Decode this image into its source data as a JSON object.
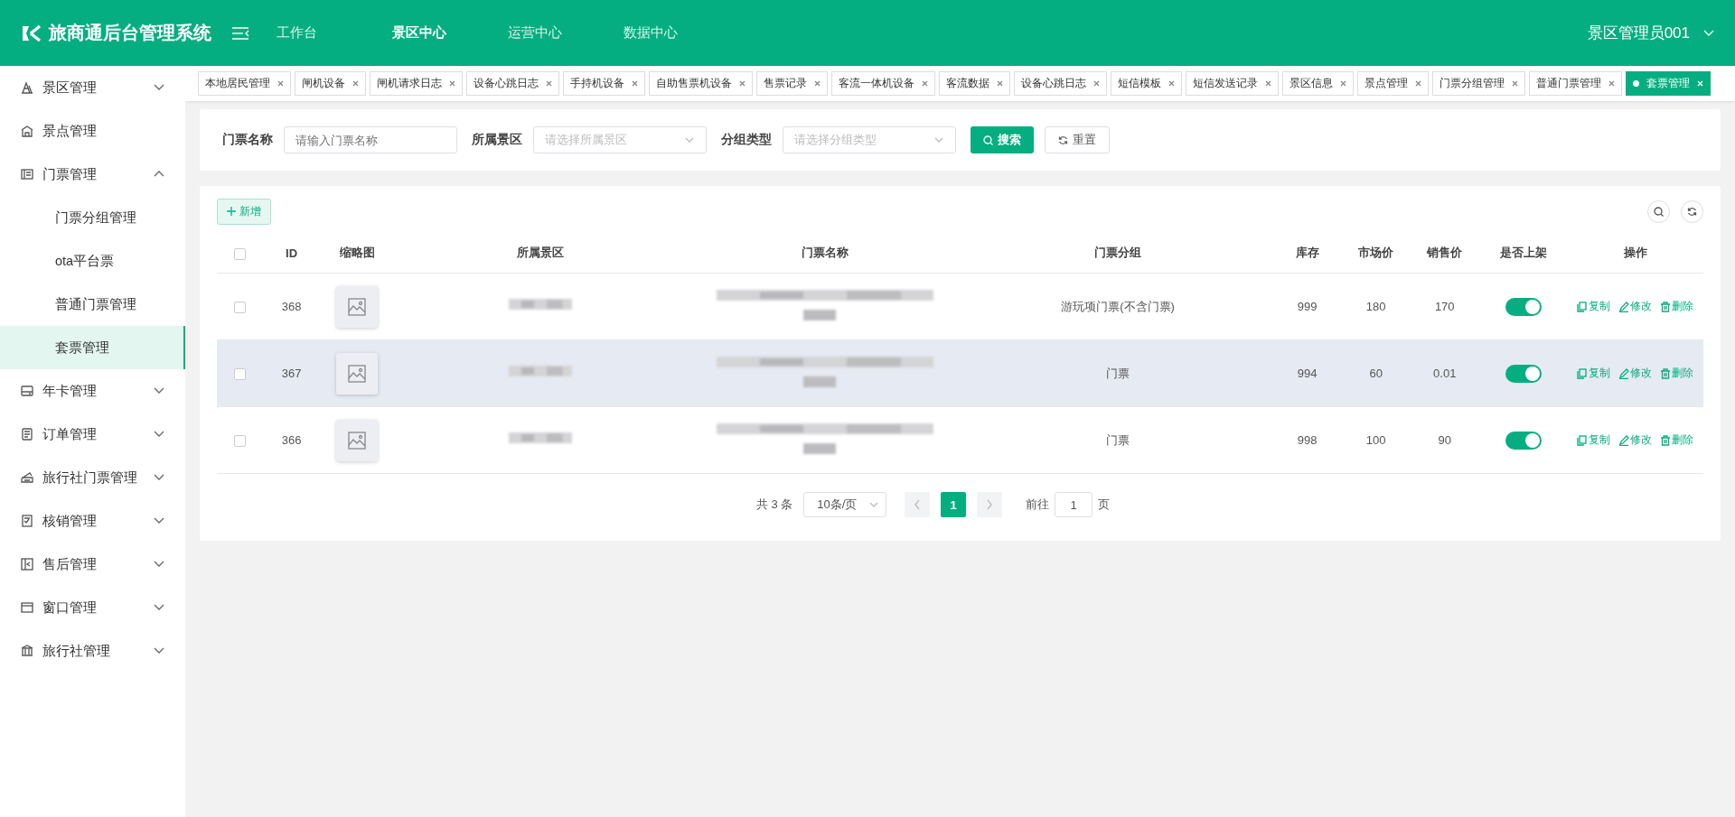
{
  "header": {
    "title": "旅商通后台管理系统",
    "nav": [
      {
        "label": "工作台",
        "selected": false
      },
      {
        "label": "景区中心",
        "selected": true
      },
      {
        "label": "运营中心",
        "selected": false
      },
      {
        "label": "数据中心",
        "selected": false
      }
    ],
    "user": "景区管理员001"
  },
  "sidebar": {
    "items": [
      {
        "label": "景区管理",
        "kind": "group",
        "expanded": false,
        "selected": false
      },
      {
        "label": "景点管理",
        "kind": "link",
        "selected": false
      },
      {
        "label": "门票管理",
        "kind": "group",
        "expanded": true,
        "selected": false,
        "children": [
          {
            "label": "门票分组管理",
            "selected": false
          },
          {
            "label": "ota平台票",
            "selected": false
          },
          {
            "label": "普通门票管理",
            "selected": false
          },
          {
            "label": "套票管理",
            "selected": true
          }
        ]
      },
      {
        "label": "年卡管理",
        "kind": "group",
        "expanded": false,
        "selected": false
      },
      {
        "label": "订单管理",
        "kind": "group",
        "expanded": false,
        "selected": false
      },
      {
        "label": "旅行社门票管理",
        "kind": "group",
        "expanded": false,
        "selected": false
      },
      {
        "label": "核销管理",
        "kind": "group",
        "expanded": false,
        "selected": false
      },
      {
        "label": "售后管理",
        "kind": "group",
        "expanded": false,
        "selected": false
      },
      {
        "label": "窗口管理",
        "kind": "group",
        "expanded": false,
        "selected": false
      },
      {
        "label": "旅行社管理",
        "kind": "group",
        "expanded": false,
        "selected": false
      }
    ]
  },
  "tabs": [
    {
      "label": "本地居民管理",
      "selected": false
    },
    {
      "label": "闸机设备",
      "selected": false
    },
    {
      "label": "闸机请求日志",
      "selected": false
    },
    {
      "label": "设备心跳日志",
      "selected": false
    },
    {
      "label": "手持机设备",
      "selected": false
    },
    {
      "label": "自助售票机设备",
      "selected": false
    },
    {
      "label": "售票记录",
      "selected": false
    },
    {
      "label": "客流一体机设备",
      "selected": false
    },
    {
      "label": "客流数据",
      "selected": false
    },
    {
      "label": "设备心跳日志",
      "selected": false
    },
    {
      "label": "短信模板",
      "selected": false
    },
    {
      "label": "短信发送记录",
      "selected": false
    },
    {
      "label": "景区信息",
      "selected": false
    },
    {
      "label": "景点管理",
      "selected": false
    },
    {
      "label": "门票分组管理",
      "selected": false
    },
    {
      "label": "普通门票管理",
      "selected": false
    },
    {
      "label": "套票管理",
      "selected": true
    }
  ],
  "search": {
    "fields": [
      {
        "label": "门票名称",
        "kind": "input",
        "placeholder": "请输入门票名称"
      },
      {
        "label": "所属景区",
        "kind": "select",
        "placeholder": "请选择所属景区"
      },
      {
        "label": "分组类型",
        "kind": "select",
        "placeholder": "请选择分组类型"
      }
    ],
    "buttons": [
      {
        "label": "搜索",
        "kind": "primary"
      },
      {
        "label": "重置",
        "kind": "plain"
      }
    ]
  },
  "table": {
    "add_button": "新增",
    "columns": [
      "ID",
      "缩略图",
      "所属景区",
      "门票名称",
      "门票分组",
      "库存",
      "市场价",
      "销售价",
      "是否上架",
      "操作"
    ],
    "header_checked": false,
    "rows": [
      {
        "checked": false,
        "hovered": false,
        "id": "368",
        "group": "游玩项门票(不含门票)",
        "stock": "999",
        "market_price": "180",
        "sale_price": "170",
        "listed": true,
        "actions": [
          "复制",
          "修改",
          "删除"
        ]
      },
      {
        "checked": false,
        "hovered": true,
        "id": "367",
        "group": "门票",
        "stock": "994",
        "market_price": "60",
        "sale_price": "0.01",
        "listed": true,
        "actions": [
          "复制",
          "修改",
          "删除"
        ]
      },
      {
        "checked": false,
        "hovered": false,
        "id": "366",
        "group": "门票",
        "stock": "998",
        "market_price": "100",
        "sale_price": "90",
        "listed": true,
        "actions": [
          "复制",
          "修改",
          "删除"
        ]
      }
    ]
  },
  "pagination": {
    "total": "共 3 条",
    "page_size": "10条/页",
    "pages": [
      {
        "label": "1",
        "selected": true
      }
    ],
    "goto_label": "前往",
    "goto_value": "1",
    "goto_suffix": "页"
  }
}
